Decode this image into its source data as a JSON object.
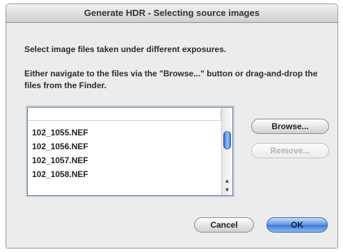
{
  "dialog": {
    "title": "Generate HDR - Selecting source images",
    "prompt": "Select image files taken under different exposures.",
    "hint": "Either navigate to the files via the \"Browse...\" button or drag-and-drop the files from the Finder."
  },
  "file_list": {
    "items": [
      "102_1055.NEF",
      "102_1056.NEF",
      "102_1057.NEF",
      "102_1058.NEF"
    ]
  },
  "buttons": {
    "browse": "Browse...",
    "remove": "Remove...",
    "cancel": "Cancel",
    "ok": "OK"
  },
  "colors": {
    "window_bg": "#ececec",
    "default_button": "#5d97e6",
    "scroll_thumb": "#3a6fd2",
    "list_focus_ring": "#b9d0ea"
  }
}
